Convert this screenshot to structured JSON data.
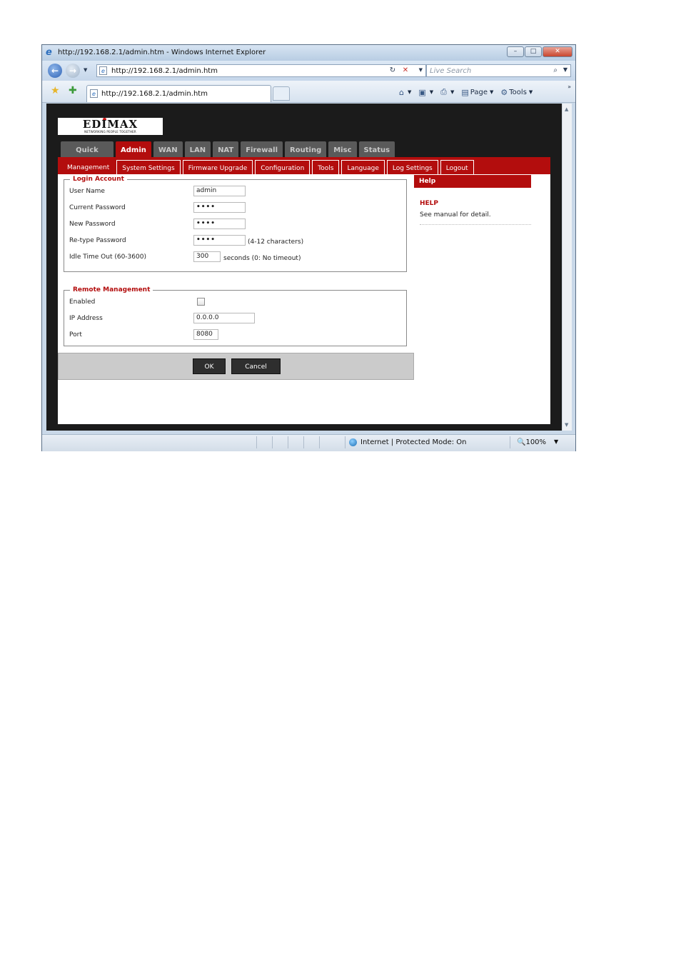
{
  "browser": {
    "window_title": "http://192.168.2.1/admin.htm - Windows Internet Explorer",
    "address": "http://192.168.2.1/admin.htm",
    "search_placeholder": "Live Search",
    "tab_title": "http://192.168.2.1/admin.htm",
    "cmd_page": "Page",
    "cmd_tools": "Tools",
    "status_zone": "Internet | Protected Mode: On",
    "zoom": "100%"
  },
  "router": {
    "logo_text": "EDIMAX",
    "logo_tagline": "NETWORKING PEOPLE TOGETHER",
    "main_tabs": [
      "Quick Setup",
      "Admin",
      "WAN",
      "LAN",
      "NAT",
      "Firewall",
      "Routing",
      "Misc",
      "Status"
    ],
    "active_main_tab": "Admin",
    "sub_tabs": [
      "Management",
      "System Settings",
      "Firmware Upgrade",
      "Configuration",
      "Tools",
      "Language",
      "Log Settings",
      "Logout"
    ],
    "active_sub_tab": "Management"
  },
  "login_account": {
    "legend": "Login Account",
    "user_name_label": "User Name",
    "user_name_value": "admin",
    "current_password_label": "Current Password",
    "current_password_value": "••••",
    "new_password_label": "New Password",
    "new_password_value": "••••",
    "retype_password_label": "Re-type Password",
    "retype_password_value": "••••",
    "password_hint": "(4-12 characters)",
    "idle_timeout_label": "Idle Time Out (60-3600)",
    "idle_timeout_value": "300",
    "idle_timeout_hint": "seconds (0: No timeout)"
  },
  "remote_management": {
    "legend": "Remote Management",
    "enabled_label": "Enabled",
    "enabled": false,
    "ip_address_label": "IP Address",
    "ip_address_value": "0.0.0.0",
    "port_label": "Port",
    "port_value": "8080"
  },
  "actions": {
    "ok_label": "OK",
    "cancel_label": "Cancel"
  },
  "help": {
    "header": "Help",
    "title": "HELP",
    "text": "See manual for detail."
  },
  "colors": {
    "accent_red": "#b30d0d",
    "inactive_tab": "#5a5a5a",
    "page_background": "#1b1b1b"
  }
}
